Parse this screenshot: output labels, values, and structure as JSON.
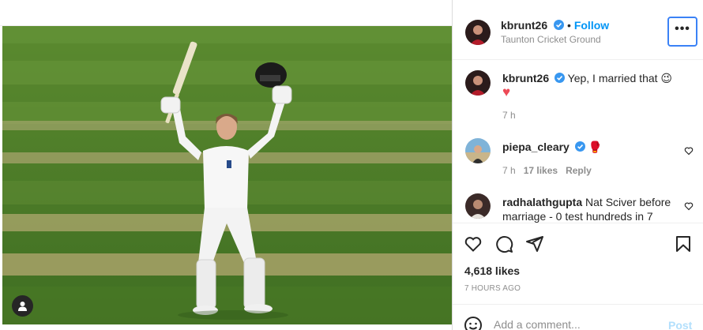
{
  "post": {
    "author": "kbrunt26",
    "follow_label": "Follow",
    "location": "Taunton Cricket Ground",
    "more_label": "•••"
  },
  "comments": [
    {
      "user": "kbrunt26",
      "text": "Yep, I married that 😉",
      "emoji_heart": "♥",
      "time": "7 h",
      "verified": true
    },
    {
      "user": "piepa_cleary",
      "text": "",
      "emoji": "🥊",
      "time": "7 h",
      "likes": "17 likes",
      "reply": "Reply",
      "verified": true
    },
    {
      "user": "radhalathgupta",
      "text": "Nat Sciver before marriage - 0 test hundreds in 7",
      "verified": false
    }
  ],
  "actions": {
    "like_icon": "heart-icon",
    "comment_icon": "comment-icon",
    "share_icon": "send-icon",
    "save_icon": "bookmark-icon"
  },
  "likes": "4,618 likes",
  "posted_time": "7 HOURS AGO",
  "add_comment": {
    "placeholder": "Add a comment...",
    "post_label": "Post"
  },
  "colors": {
    "accent": "#0095f6",
    "verified": "#3897f0",
    "post_disabled": "#b2dffc",
    "muted": "#8e8e8e"
  }
}
